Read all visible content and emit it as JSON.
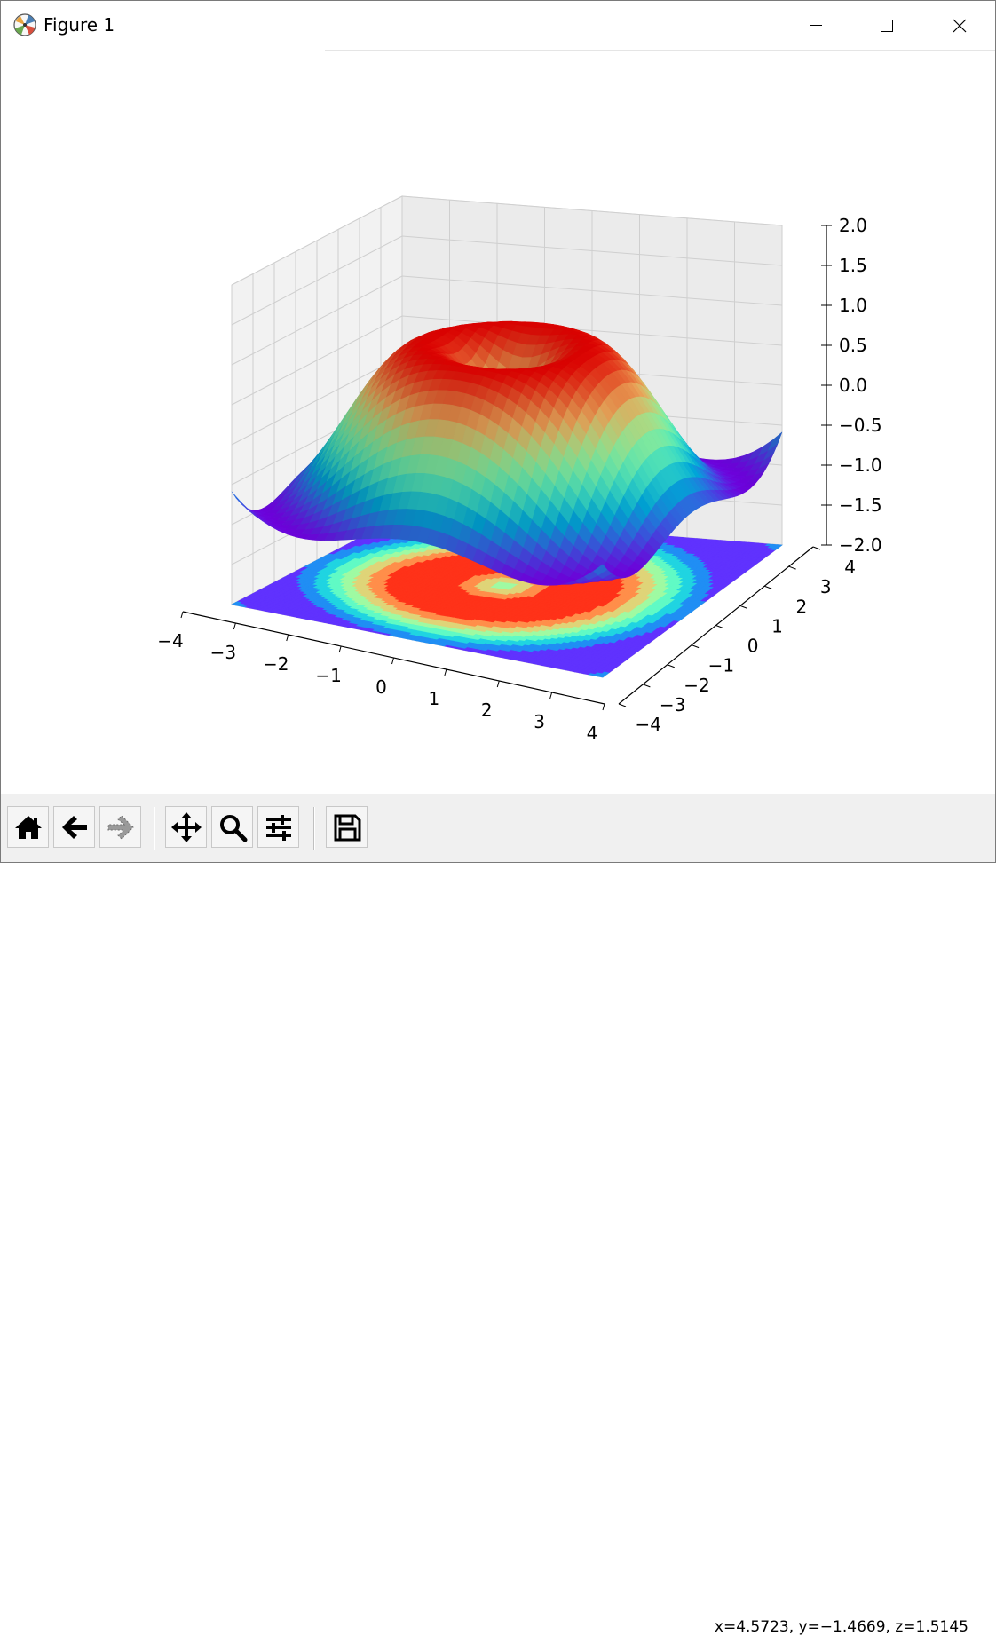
{
  "window": {
    "title": "Figure 1",
    "controls": {
      "minimize": "minimize",
      "maximize": "maximize",
      "close": "close"
    }
  },
  "toolbar": {
    "buttons": [
      {
        "name": "home-button",
        "icon": "home-icon"
      },
      {
        "name": "back-button",
        "icon": "arrow-left-icon"
      },
      {
        "name": "forward-button",
        "icon": "arrow-right-icon"
      },
      {
        "name": "pan-button",
        "icon": "move-icon"
      },
      {
        "name": "zoom-button",
        "icon": "search-icon"
      },
      {
        "name": "configure-subplots-button",
        "icon": "sliders-icon"
      },
      {
        "name": "save-button",
        "icon": "floppy-disk-icon"
      }
    ],
    "coords": "x=4.5723, y=−1.4669, z=1.5145"
  },
  "chart_data": {
    "type": "surface3d",
    "function": "z = sin(sqrt(x^2 + y^2))",
    "colormap": "rainbow",
    "x_range": [
      -4,
      4
    ],
    "y_range": [
      -4,
      4
    ],
    "zlim": [
      -2,
      2
    ],
    "contour_projection": "filled contours of the surface projected on the z = -2 plane",
    "x_ticks": [
      "−4",
      "−3",
      "−2",
      "−1",
      "0",
      "1",
      "2",
      "3",
      "4"
    ],
    "y_ticks": [
      "−4",
      "−3",
      "−2",
      "−1",
      "0",
      "1",
      "2",
      "3",
      "4"
    ],
    "z_ticks": [
      "−2.0",
      "−1.5",
      "−1.0",
      "−0.5",
      "0.0",
      "0.5",
      "1.0",
      "1.5",
      "2.0"
    ],
    "grid": true
  }
}
